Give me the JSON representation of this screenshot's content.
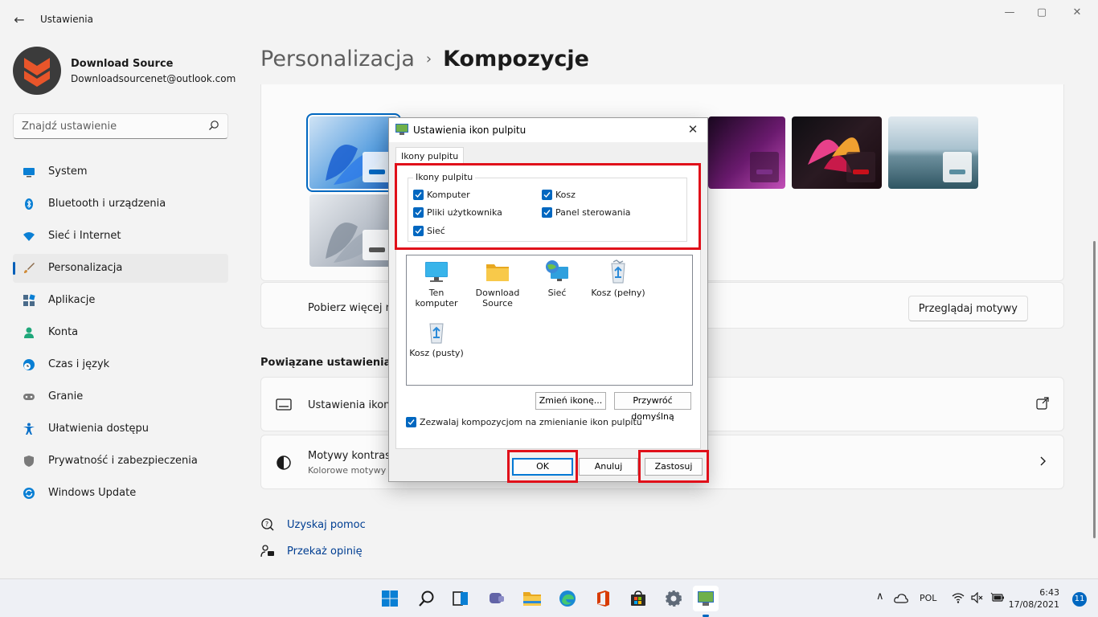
{
  "window": {
    "title": "Ustawienia",
    "back_glyph": "←",
    "minimize_glyph": "—",
    "maximize_glyph": "▢",
    "close_glyph": "✕"
  },
  "profile": {
    "name": "Download Source",
    "email": "Downloadsourcenet@outlook.com",
    "avatar_colors": {
      "bg": "#3b3b3b",
      "logo": "#e8552a"
    }
  },
  "search": {
    "placeholder": "Znajdź ustawienie",
    "value": ""
  },
  "sidebar": {
    "items": [
      {
        "label": "System",
        "icon": "system-monitor-icon",
        "color": "#0067c0"
      },
      {
        "label": "Bluetooth i urządzenia",
        "icon": "bluetooth-icon",
        "color": "#0067c0"
      },
      {
        "label": "Sieć i Internet",
        "icon": "wifi-icon",
        "color": "#0067c0"
      },
      {
        "label": "Personalizacja",
        "icon": "paint-brush-icon",
        "color": "#d08a35",
        "active": true
      },
      {
        "label": "Aplikacje",
        "icon": "apps-icon",
        "color": "#4a6b8a"
      },
      {
        "label": "Konta",
        "icon": "account-icon",
        "color": "#1fa77a"
      },
      {
        "label": "Czas i język",
        "icon": "clock-globe-icon",
        "color": "#0067c0"
      },
      {
        "label": "Granie",
        "icon": "gamepad-icon",
        "color": "#7a7a7a"
      },
      {
        "label": "Ułatwienia dostępu",
        "icon": "accessibility-icon",
        "color": "#0a70c8"
      },
      {
        "label": "Prywatność i zabezpieczenia",
        "icon": "shield-icon",
        "color": "#7a7a7a"
      },
      {
        "label": "Windows Update",
        "icon": "windows-update-icon",
        "color": "#0067c0"
      }
    ]
  },
  "breadcrumb": {
    "parent": "Personalizacja",
    "separator": "›",
    "current": "Kompozycje"
  },
  "themes": {
    "get_more_text": "Pobierz więcej m",
    "browse_button": "Przeglądaj motywy"
  },
  "related": {
    "section_title": "Powiązane ustawienia",
    "desktop_icons": {
      "title": "Ustawienia ikon"
    },
    "contrast": {
      "title": "Motywy kontrast",
      "subtitle": "Kolorowe motywy"
    }
  },
  "help": {
    "get_help": "Uzyskaj pomoc",
    "feedback": "Przekaż opinię"
  },
  "dialog": {
    "title": "Ustawienia ikon pulpitu",
    "close_glyph": "✕",
    "tab": "Ikony pulpitu",
    "group_label": "Ikony pulpitu",
    "checkboxes": {
      "computer": "Komputer",
      "recycle_bin": "Kosz",
      "user_files": "Pliki użytkownika",
      "control_panel": "Panel sterowania",
      "network": "Sieć"
    },
    "icons": [
      {
        "label": "Ten komputer",
        "icon": "monitor-icon"
      },
      {
        "label": "Download Source",
        "icon": "folder-icon"
      },
      {
        "label": "Sieć",
        "icon": "network-globe-icon"
      },
      {
        "label": "Kosz (pełny)",
        "icon": "recycle-bin-full-icon"
      },
      {
        "label": "Kosz (pusty)",
        "icon": "recycle-bin-empty-icon"
      }
    ],
    "change_icon_button": "Zmień ikonę...",
    "restore_default_button": "Przywróć domyślną",
    "allow_themes_checkbox": "Zezwalaj kompozycjom na zmienianie ikon pulpitu",
    "ok_button": "OK",
    "cancel_button": "Anuluj",
    "apply_button": "Zastosuj"
  },
  "taskbar": {
    "icons": [
      "windows-start-icon",
      "search-icon",
      "task-view-icon",
      "teams-chat-icon",
      "file-explorer-icon",
      "edge-icon",
      "office-icon",
      "store-icon",
      "settings-gear-icon",
      "desktop-icon-settings-app-icon"
    ],
    "language": "POL",
    "time": "6:43",
    "date": "17/08/2021",
    "notification_count": "11",
    "chevron_glyph": "∧"
  },
  "colors": {
    "accent": "#0067c0",
    "highlight_red": "#e0101a",
    "link": "#003e92"
  }
}
